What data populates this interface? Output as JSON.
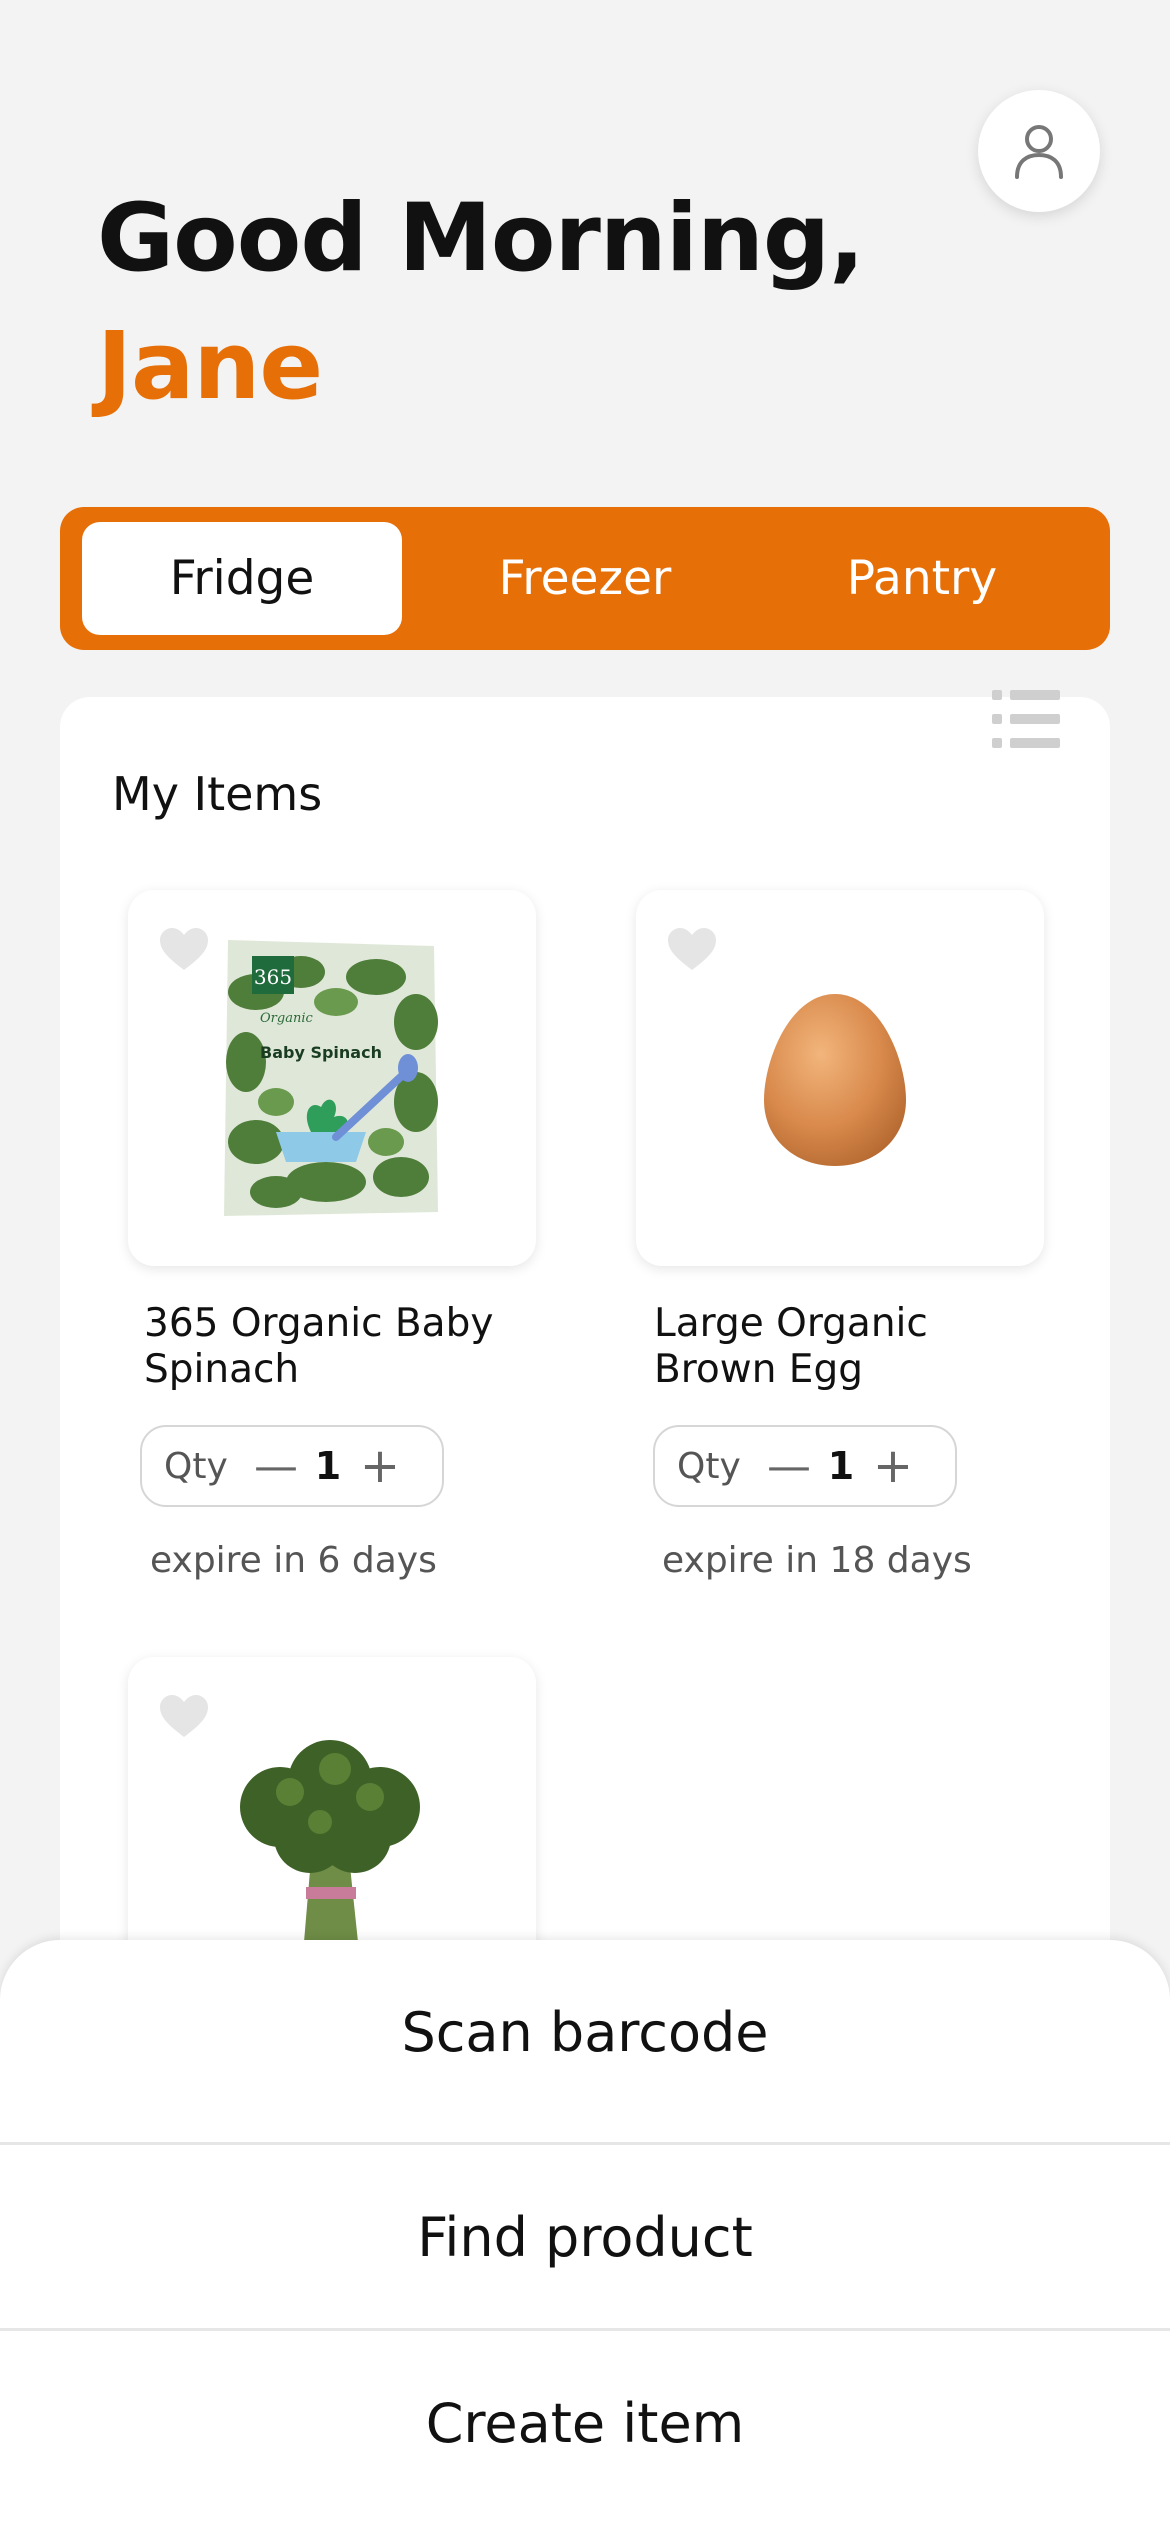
{
  "greeting": {
    "line1": "Good Morning,",
    "name": "Jane"
  },
  "tabs": [
    {
      "label": "Fridge",
      "active": true
    },
    {
      "label": "Freezer",
      "active": false
    },
    {
      "label": "Pantry",
      "active": false
    }
  ],
  "panel": {
    "title": "My Items"
  },
  "items": [
    {
      "name": "365 Organic Baby Spinach",
      "qty_label": "Qty",
      "qty": "1",
      "expiry": "expire in 6 days",
      "image": "spinach-bag",
      "package_text": [
        "365",
        "Organic",
        "Baby Spinach"
      ]
    },
    {
      "name": "Large Organic Brown Egg",
      "qty_label": "Qty",
      "qty": "1",
      "expiry": "expire in 18 days",
      "image": "brown-egg"
    },
    {
      "name": "",
      "image": "broccoli"
    }
  ],
  "sheet": {
    "scan": "Scan barcode",
    "find": "Find product",
    "create": "Create item"
  },
  "colors": {
    "accent": "#e76f07",
    "background": "#f3f3f3"
  }
}
